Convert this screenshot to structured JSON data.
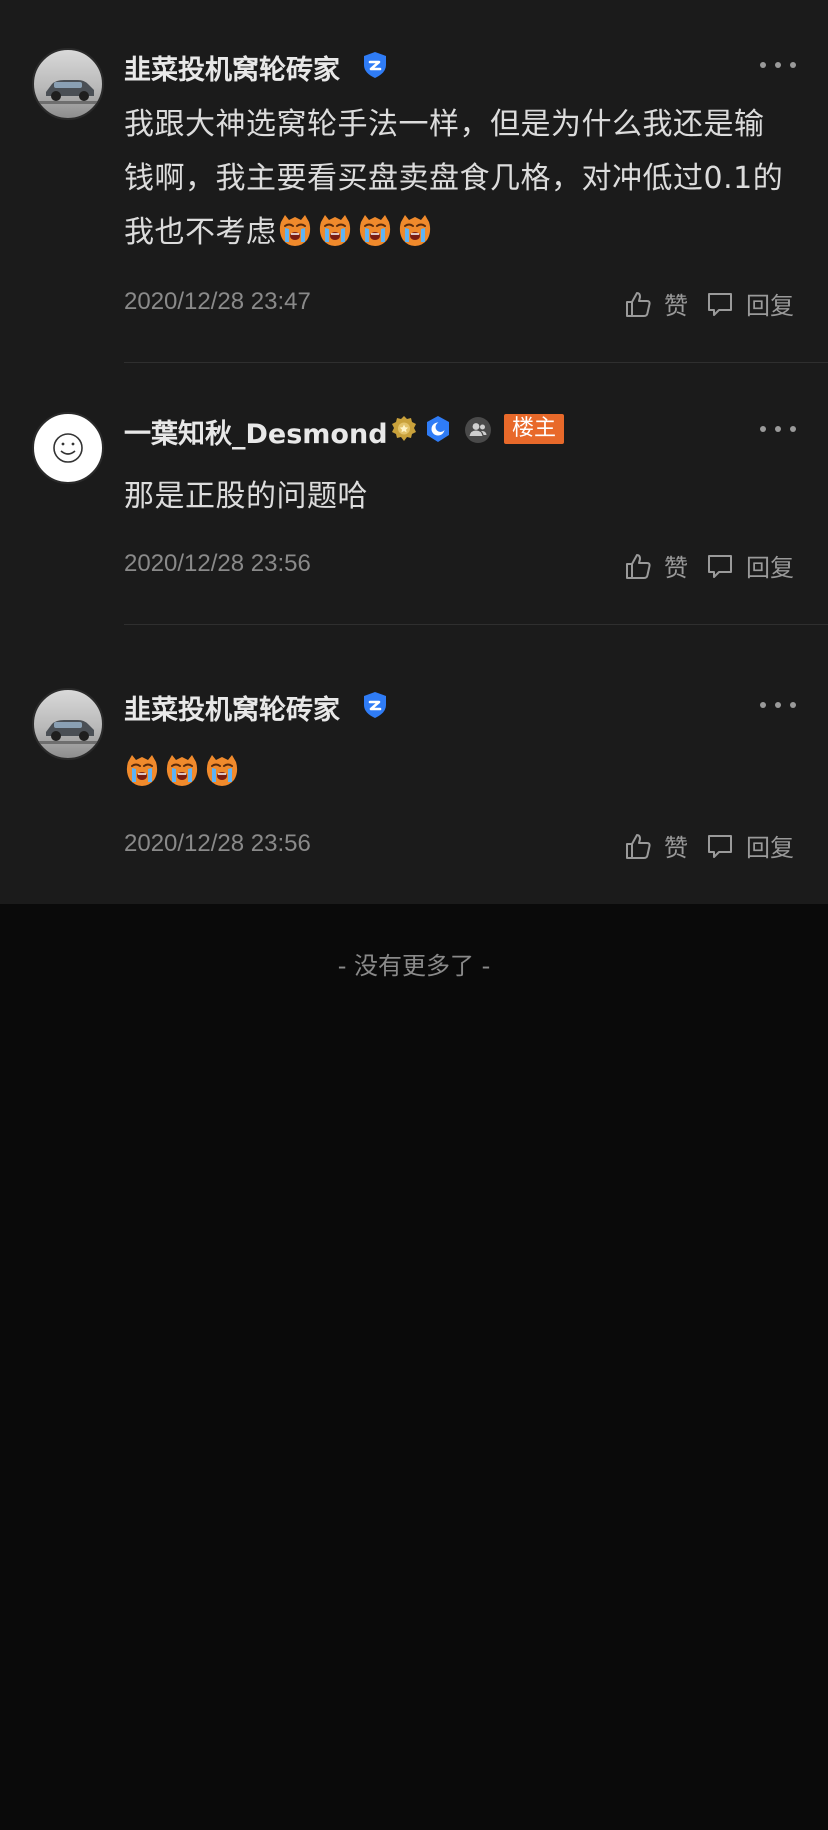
{
  "comments": [
    {
      "username": "韭菜投机窝轮砖家",
      "text": "我跟大神选窝轮手法一样，但是为什么我还是输钱啊，我主要看买盘卖盘食几格，对冲低过0.1的我也不考虑",
      "emoji_count": 4,
      "time": "2020/12/28 23:47",
      "like_label": "赞",
      "reply_label": "回复"
    },
    {
      "username": "一葉知秋_Desmond",
      "op_tag": "楼主",
      "text": "那是正股的问题哈",
      "time": "2020/12/28 23:56",
      "like_label": "赞",
      "reply_label": "回复"
    },
    {
      "username": "韭菜投机窝轮砖家",
      "text": "",
      "emoji_count": 3,
      "time": "2020/12/28 23:56",
      "like_label": "赞",
      "reply_label": "回复"
    }
  ],
  "footer_text": "- 没有更多了 -",
  "colors": {
    "background": "#0a0a0a",
    "panel": "#1b1b1b",
    "verified_blue": "#2f7cf6",
    "op_tag": "#e8692a",
    "gold_badge": "#c9a13b"
  },
  "icons": [
    "verified-shield-icon",
    "gold-medal-icon",
    "blue-circle-badge-icon",
    "group-icon",
    "more-dots-icon",
    "thumb-up-icon",
    "comment-icon",
    "crying-emoji-icon"
  ]
}
